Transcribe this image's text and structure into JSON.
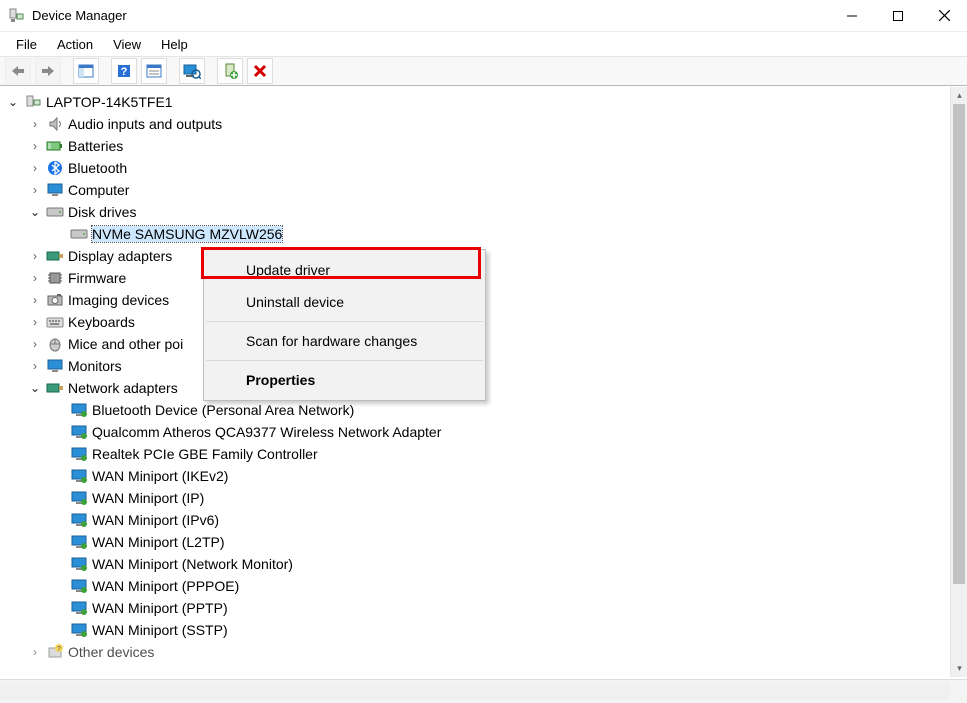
{
  "window": {
    "title": "Device Manager"
  },
  "menubar": {
    "file": "File",
    "action": "Action",
    "view": "View",
    "help": "Help"
  },
  "tree": {
    "root": "LAPTOP-14K5TFE1",
    "audio": "Audio inputs and outputs",
    "batteries": "Batteries",
    "bluetooth": "Bluetooth",
    "computer": "Computer",
    "disk_drives": "Disk drives",
    "nvme": "NVMe SAMSUNG MZVLW256",
    "display_adapters": "Display adapters",
    "firmware": "Firmware",
    "imaging": "Imaging devices",
    "keyboards": "Keyboards",
    "mice": "Mice and other poi",
    "monitors": "Monitors",
    "network_adapters": "Network adapters",
    "net_bt": "Bluetooth Device (Personal Area Network)",
    "net_qca": "Qualcomm Atheros QCA9377 Wireless Network Adapter",
    "net_rtk": "Realtek PCIe GBE Family Controller",
    "net_ikev2": "WAN Miniport (IKEv2)",
    "net_ip": "WAN Miniport (IP)",
    "net_ipv6": "WAN Miniport (IPv6)",
    "net_l2tp": "WAN Miniport (L2TP)",
    "net_monitor": "WAN Miniport (Network Monitor)",
    "net_pppoe": "WAN Miniport (PPPOE)",
    "net_pptp": "WAN Miniport (PPTP)",
    "net_sstp": "WAN Miniport (SSTP)",
    "other_devices": "Other devices"
  },
  "context_menu": {
    "update_driver": "Update driver",
    "uninstall": "Uninstall device",
    "scan": "Scan for hardware changes",
    "properties": "Properties"
  }
}
